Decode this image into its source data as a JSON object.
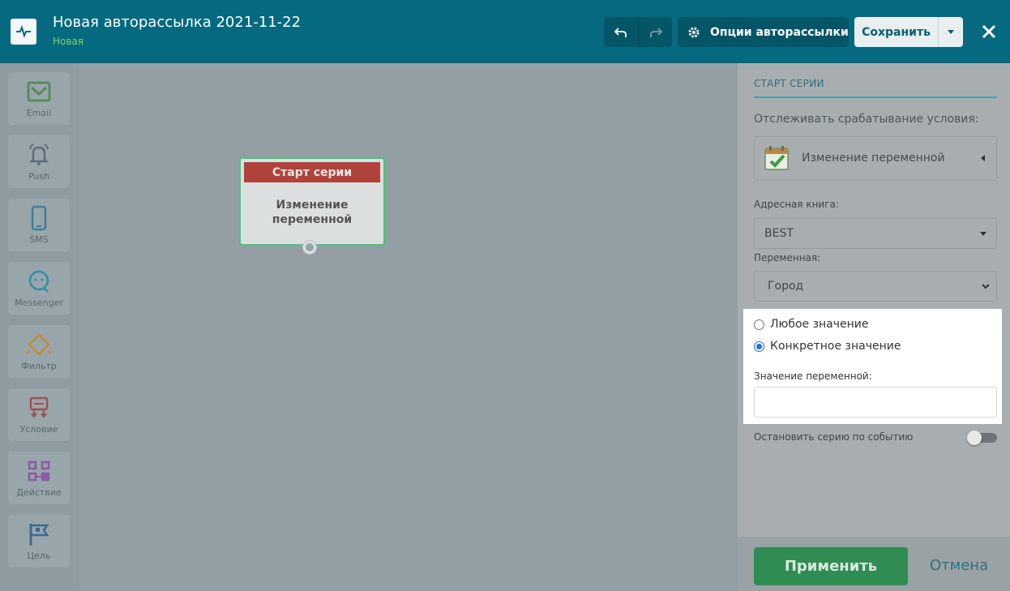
{
  "header": {
    "title": "Новая авторассылка 2021-11-22",
    "status": "Новая",
    "options_label": "Опции авторассылки",
    "save_label": "Сохранить",
    "logo_icon": "pulse-icon",
    "undo_icon": "undo-icon",
    "redo_icon": "redo-icon",
    "close_icon": "close-icon"
  },
  "palette": {
    "items": [
      {
        "label": "Email",
        "icon": "envelope-icon",
        "color": "#5a8a5a"
      },
      {
        "label": "Push",
        "icon": "bell-icon",
        "color": "#5c6e78"
      },
      {
        "label": "SMS",
        "icon": "phone-icon",
        "color": "#3f7f95"
      },
      {
        "label": "Messenger",
        "icon": "chat-icon",
        "color": "#2f8fa3"
      },
      {
        "label": "Фильтр",
        "icon": "filter-icon",
        "color": "#c68a33"
      },
      {
        "label": "Условие",
        "icon": "condition-icon",
        "color": "#a0504e"
      },
      {
        "label": "Действие",
        "icon": "action-icon",
        "color": "#8a5aa2"
      },
      {
        "label": "Цель",
        "icon": "flag-icon",
        "color": "#3c6a8e"
      }
    ]
  },
  "canvas": {
    "node": {
      "header": "Старт серии",
      "body_line1": "Изменение",
      "body_line2": "переменной"
    }
  },
  "panel": {
    "title": "СТАРТ СЕРИИ",
    "track_label": "Отслеживать срабатывание условия:",
    "condition": "Изменение переменной",
    "address_book_label": "Адресная книга:",
    "address_book_value": "BEST",
    "variable_label": "Переменная:",
    "variable_value": "Город",
    "radio_any": "Любое значение",
    "radio_specific": "Конкретное значение",
    "value_label": "Значение переменной:",
    "value_input": "",
    "stop_label": "Остановить серию по событию",
    "apply_label": "Применить",
    "cancel_label": "Отмена"
  },
  "colors": {
    "header_bg": "#056a80",
    "accent_green": "#2f8c52",
    "node_head": "#b0423c"
  }
}
